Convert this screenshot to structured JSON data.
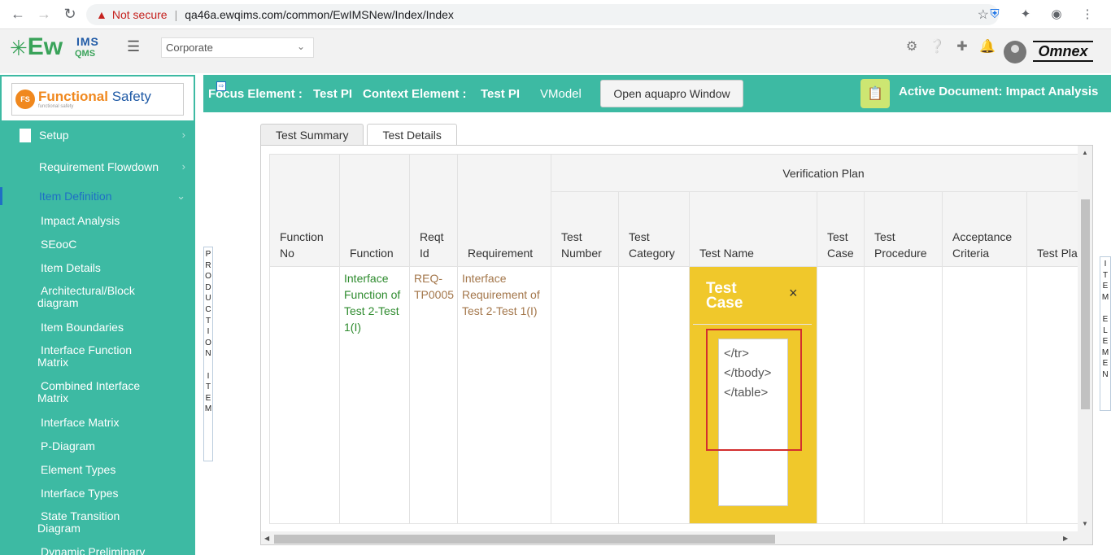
{
  "browser": {
    "not_secure": "Not secure",
    "url": "qa46a.ewqims.com/common/EwIMSNew/Index/Index"
  },
  "header": {
    "logo_ew": "Ew",
    "logo_ims": "IMS",
    "logo_qms": "QMS",
    "org_select_value": "Corporate",
    "brand": "Omnex"
  },
  "sidebar": {
    "module_title_part1": "Functional",
    "module_title_part2": "Safety",
    "module_subtitle": "functional safety",
    "items": [
      {
        "label": "Setup"
      },
      {
        "label": "Requirement Flowdown"
      },
      {
        "label": "Item Definition"
      },
      {
        "label": "Impact Analysis"
      },
      {
        "label": "SEooC"
      },
      {
        "label": "Item Details"
      },
      {
        "label": "Architectural/Block diagram"
      },
      {
        "label": "Item Boundaries"
      },
      {
        "label": "Interface Function Matrix"
      },
      {
        "label": "Combined Interface Matrix"
      },
      {
        "label": "Interface Matrix"
      },
      {
        "label": "P-Diagram"
      },
      {
        "label": "Element Types"
      },
      {
        "label": "Interface Types"
      },
      {
        "label": "State Transition Diagram"
      },
      {
        "label": "Dynamic Preliminary"
      }
    ]
  },
  "context_bar": {
    "focus_label": "Focus Element :",
    "focus_value": "Test PI",
    "context_label": "Context Element :",
    "context_value": "Test PI",
    "vmodel": "VModel",
    "open_button": "Open aquapro Window",
    "active_document": "Active Document: Impact Analysis"
  },
  "side_labels": {
    "left": "PRODUCTION ITEM",
    "right": "ITEM ELEMEN"
  },
  "tabs": [
    {
      "label": "Test Summary"
    },
    {
      "label": "Test Details"
    }
  ],
  "table": {
    "group_header": "Verification Plan",
    "columns": [
      "Function No",
      "Function",
      "Reqt Id",
      "Requirement",
      "Test Number",
      "Test Category",
      "Test Name",
      "Test Case",
      "Test Procedure",
      "Acceptance Criteria",
      "Test Plan"
    ],
    "row": {
      "function_no": "",
      "function": "Interface Function of Test 2-Test 1(I)",
      "reqt_id": "REQ-TP0005",
      "requirement": "Interface Requirement of Test 2-Test 1(I)"
    }
  },
  "popup": {
    "title": "Test Case",
    "close": "×",
    "textarea_value": "</tr>\n</tbody>\n</table>"
  }
}
